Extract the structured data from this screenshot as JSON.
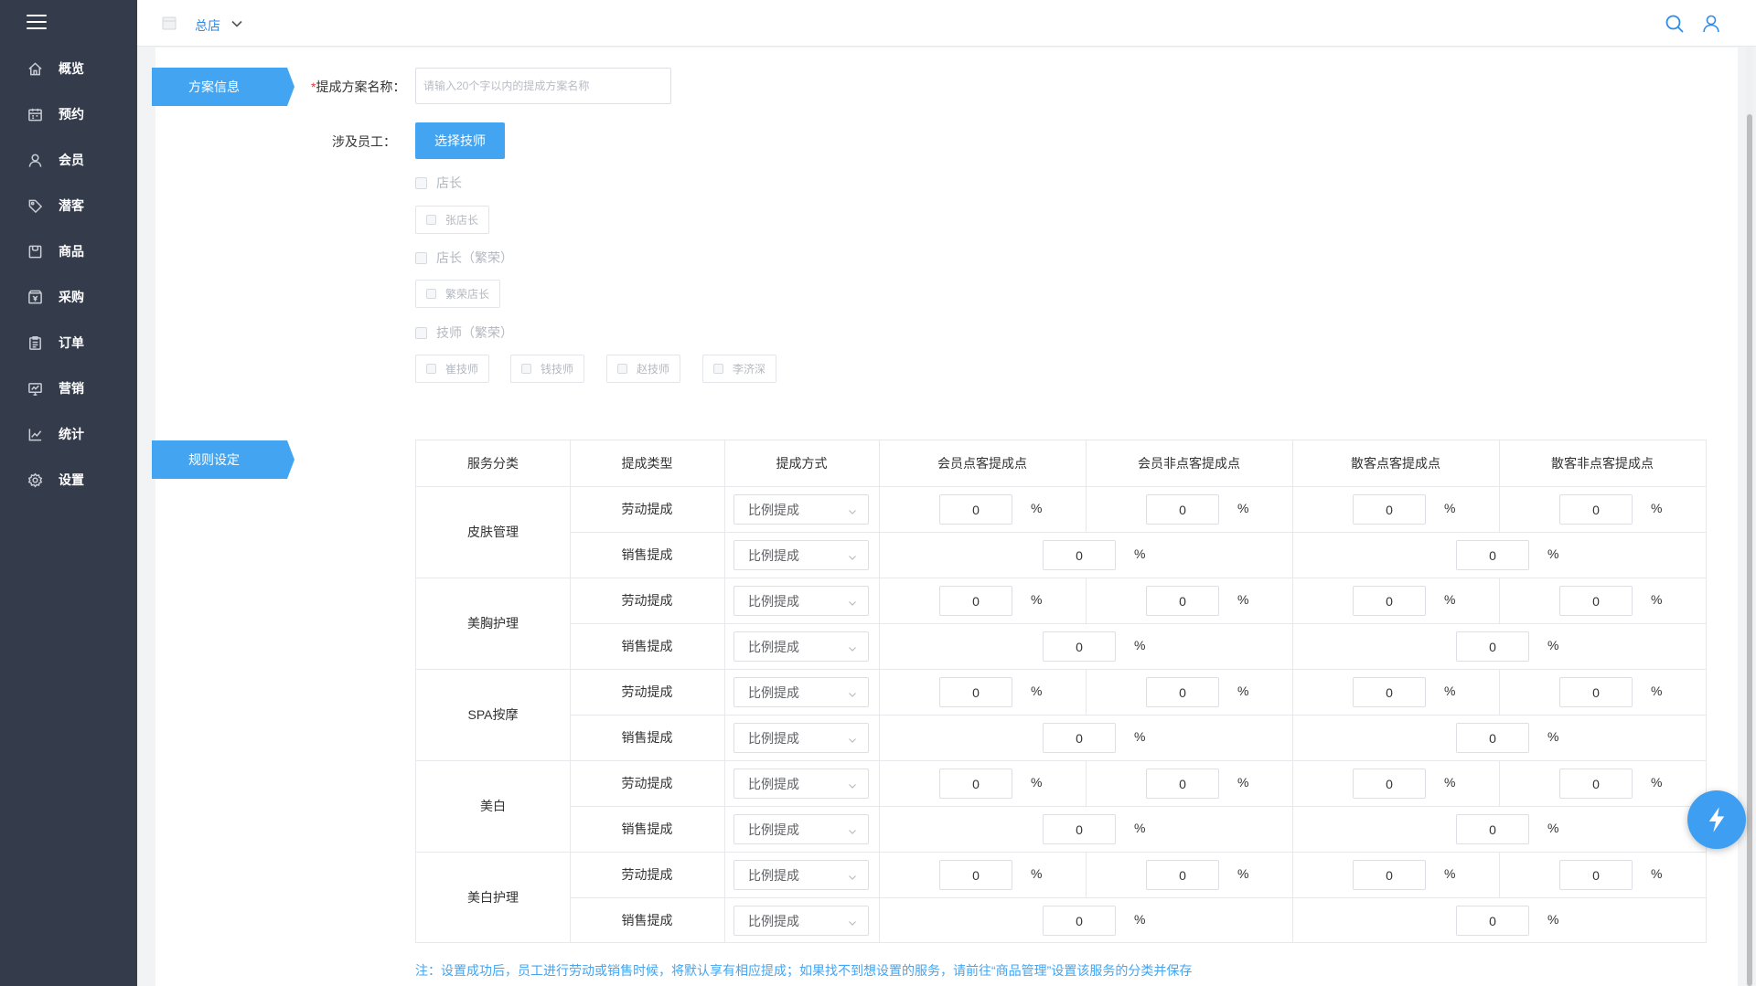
{
  "sidebar": {
    "items": [
      {
        "label": "概览",
        "icon": "home-icon"
      },
      {
        "label": "预约",
        "icon": "calendar-icon"
      },
      {
        "label": "会员",
        "icon": "user-icon"
      },
      {
        "label": "潜客",
        "icon": "tag-icon"
      },
      {
        "label": "商品",
        "icon": "box-icon"
      },
      {
        "label": "采购",
        "icon": "cart-icon"
      },
      {
        "label": "订单",
        "icon": "clipboard-icon"
      },
      {
        "label": "营销",
        "icon": "monitor-icon"
      },
      {
        "label": "统计",
        "icon": "chart-icon"
      },
      {
        "label": "设置",
        "icon": "gear-icon"
      }
    ]
  },
  "header": {
    "store_name": "总店"
  },
  "sections": {
    "info": "方案信息",
    "rules": "规则设定"
  },
  "form": {
    "name_required_mark": "*",
    "name_label": "提成方案名称：",
    "name_placeholder": "请输入20个字以内的提成方案名称",
    "staff_label": "涉及员工：",
    "select_button": "选择技师"
  },
  "staff_groups": [
    {
      "name": "店长",
      "members": [
        "张店长"
      ]
    },
    {
      "name": "店长（繁荣）",
      "members": [
        "繁荣店长"
      ]
    },
    {
      "name": "技师（繁荣）",
      "members": [
        "崔技师",
        "钱技师",
        "赵技师",
        "李济深"
      ]
    }
  ],
  "table": {
    "headers": [
      "服务分类",
      "提成类型",
      "提成方式",
      "会员点客提成点",
      "会员非点客提成点",
      "散客点客提成点",
      "散客非点客提成点"
    ],
    "labor_label": "劳动提成",
    "sales_label": "销售提成",
    "method_label": "比例提成",
    "percent": "%",
    "categories": [
      {
        "name": "皮肤管理",
        "labor": [
          "0",
          "0",
          "0",
          "0"
        ],
        "sales": [
          "0",
          "0"
        ]
      },
      {
        "name": "美胸护理",
        "labor": [
          "0",
          "0",
          "0",
          "0"
        ],
        "sales": [
          "0",
          "0"
        ]
      },
      {
        "name": "SPA按摩",
        "labor": [
          "0",
          "0",
          "0",
          "0"
        ],
        "sales": [
          "0",
          "0"
        ]
      },
      {
        "name": "美白",
        "labor": [
          "0",
          "0",
          "0",
          "0"
        ],
        "sales": [
          "0",
          "0"
        ]
      },
      {
        "name": "美白护理",
        "labor": [
          "0",
          "0",
          "0",
          "0"
        ],
        "sales": [
          "0",
          "0"
        ]
      }
    ]
  },
  "note": "注：设置成功后，员工进行劳动或销售时候，将默认享有相应提成；如果找不到想设置的服务，请前往“商品管理”设置该服务的分类并保存",
  "colors": {
    "sidebar_bg": "#343b4b",
    "accent": "#43a5f2",
    "required": "#e53935"
  }
}
